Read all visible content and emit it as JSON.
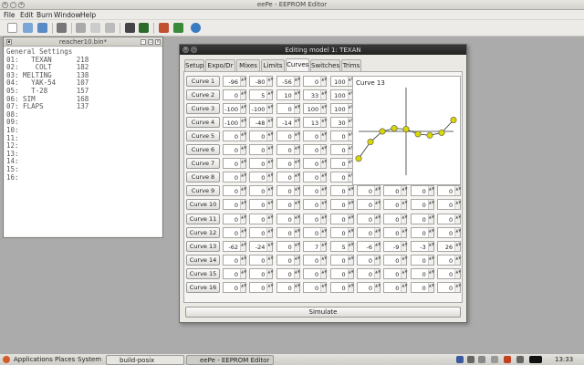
{
  "app": {
    "title": "eePe - EEPROM Editor"
  },
  "menu": [
    "File",
    "Edit",
    "Burn",
    "Window",
    "Help"
  ],
  "left_window": {
    "title": "reacher10.bin*",
    "lines": [
      "General Settings",
      "01:   TEXAN      218",
      "02:    COLT      182",
      "03: MELTING      138",
      "04:   YAK-54     107",
      "05:   T-28       157",
      "06: SIM          168",
      "07: FLAPS        137",
      "08:",
      "09:",
      "10:",
      "11:",
      "12:",
      "13:",
      "14:",
      "15:",
      "16:"
    ]
  },
  "dialog": {
    "title": "Editing model 1:  TEXAN",
    "tabs": [
      "Setup",
      "Expo/Dr",
      "Mixes",
      "Limits",
      "Curves",
      "Switches",
      "Trims"
    ],
    "active_tab": "Curves",
    "curves": [
      {
        "label": "Curve 1",
        "values": [
          "-96",
          "-80",
          "-56",
          "0",
          "100"
        ]
      },
      {
        "label": "Curve 2",
        "values": [
          "0",
          "5",
          "10",
          "33",
          "100"
        ]
      },
      {
        "label": "Curve 3",
        "values": [
          "-100",
          "-100",
          "0",
          "100",
          "100"
        ]
      },
      {
        "label": "Curve 4",
        "values": [
          "-100",
          "-48",
          "-14",
          "13",
          "30"
        ]
      },
      {
        "label": "Curve 5",
        "values": [
          "0",
          "0",
          "0",
          "0",
          "0"
        ]
      },
      {
        "label": "Curve 6",
        "values": [
          "0",
          "0",
          "0",
          "0",
          "0"
        ]
      },
      {
        "label": "Curve 7",
        "values": [
          "0",
          "0",
          "0",
          "0",
          "0"
        ]
      },
      {
        "label": "Curve 8",
        "values": [
          "0",
          "0",
          "0",
          "0",
          "0"
        ]
      },
      {
        "label": "Curve 9",
        "values": [
          "0",
          "0",
          "0",
          "0",
          "0",
          "0",
          "0",
          "0",
          "0"
        ]
      },
      {
        "label": "Curve 10",
        "values": [
          "0",
          "0",
          "0",
          "0",
          "0",
          "0",
          "0",
          "0",
          "0"
        ]
      },
      {
        "label": "Curve 11",
        "values": [
          "0",
          "0",
          "0",
          "0",
          "0",
          "0",
          "0",
          "0",
          "0"
        ]
      },
      {
        "label": "Curve 12",
        "values": [
          "0",
          "0",
          "0",
          "0",
          "0",
          "0",
          "0",
          "0",
          "0"
        ]
      },
      {
        "label": "Curve 13",
        "values": [
          "-62",
          "-24",
          "0",
          "7",
          "5",
          "-6",
          "-9",
          "-3",
          "26"
        ]
      },
      {
        "label": "Curve 14",
        "values": [
          "0",
          "0",
          "0",
          "0",
          "0",
          "0",
          "0",
          "0",
          "0"
        ]
      },
      {
        "label": "Curve 15",
        "values": [
          "0",
          "0",
          "0",
          "0",
          "0",
          "0",
          "0",
          "0",
          "0"
        ]
      },
      {
        "label": "Curve 16",
        "values": [
          "0",
          "0",
          "0",
          "0",
          "0",
          "0",
          "0",
          "0",
          "0"
        ]
      }
    ],
    "preview": {
      "title": "Curve 13",
      "points": [
        -62,
        -24,
        0,
        7,
        5,
        -6,
        -9,
        -3,
        26
      ],
      "point_color": "#d8d800"
    },
    "simulate_label": "Simulate"
  },
  "taskbar": {
    "menus": [
      "Applications",
      "Places",
      "System"
    ],
    "tasks": [
      "build-posix",
      "eePe - EEPROM Editor"
    ],
    "clock": "13:33"
  }
}
